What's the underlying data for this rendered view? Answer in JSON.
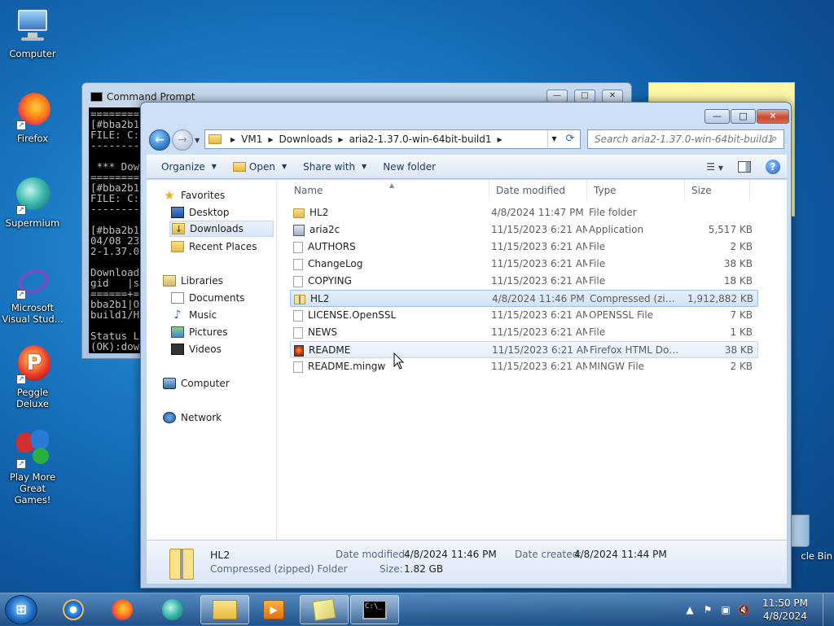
{
  "desktop": {
    "icons": [
      {
        "label": "Computer"
      },
      {
        "label": "Firefox"
      },
      {
        "label": "Supermium"
      },
      {
        "label": "Microsoft Visual Stud..."
      },
      {
        "label": "Peggle Deluxe"
      },
      {
        "label": "Play More Great Games!"
      }
    ],
    "recycle_label": "cle Bin"
  },
  "cmd": {
    "title": "Command Prompt",
    "lines": "========\n[#bba2b1\nFILE: C:\n--------\n\n *** Dow\n========\n[#bba2b1\nFILE: C:\n--------\n\n[#bba2b1\n04/08 23\n2-1.37.0\n\nDownload\ngid   |s\n======+=\nbba2b1|O\nbuild1/H\n\nStatus L\n(OK):dow\n\nC:\\Users"
  },
  "explorer": {
    "address": [
      "VM1",
      "Downloads",
      "aria2-1.37.0-win-64bit-build1"
    ],
    "search_placeholder": "Search aria2-1.37.0-win-64bit-build1",
    "toolbar": {
      "organize": "Organize",
      "open": "Open",
      "share_with": "Share with",
      "new_folder": "New folder"
    },
    "nav": {
      "favorites": "Favorites",
      "desktop": "Desktop",
      "downloads": "Downloads",
      "recent": "Recent Places",
      "libraries": "Libraries",
      "documents": "Documents",
      "music": "Music",
      "pictures": "Pictures",
      "videos": "Videos",
      "computer": "Computer",
      "network": "Network"
    },
    "columns": {
      "name": "Name",
      "date": "Date modified",
      "type": "Type",
      "size": "Size"
    },
    "files": [
      {
        "name": "HL2",
        "date": "4/8/2024 11:47 PM",
        "type": "File folder",
        "size": "",
        "icon": "folder-icon"
      },
      {
        "name": "aria2c",
        "date": "11/15/2023 6:21 AM",
        "type": "Application",
        "size": "5,517 KB",
        "icon": "application-icon"
      },
      {
        "name": "AUTHORS",
        "date": "11/15/2023 6:21 AM",
        "type": "File",
        "size": "2 KB",
        "icon": "file-icon"
      },
      {
        "name": "ChangeLog",
        "date": "11/15/2023 6:21 AM",
        "type": "File",
        "size": "38 KB",
        "icon": "file-icon"
      },
      {
        "name": "COPYING",
        "date": "11/15/2023 6:21 AM",
        "type": "File",
        "size": "18 KB",
        "icon": "file-icon"
      },
      {
        "name": "HL2",
        "date": "4/8/2024 11:46 PM",
        "type": "Compressed (zipp...",
        "size": "1,912,882 KB",
        "icon": "zip-icon"
      },
      {
        "name": "LICENSE.OpenSSL",
        "date": "11/15/2023 6:21 AM",
        "type": "OPENSSL File",
        "size": "7 KB",
        "icon": "file-icon"
      },
      {
        "name": "NEWS",
        "date": "11/15/2023 6:21 AM",
        "type": "File",
        "size": "1 KB",
        "icon": "file-icon"
      },
      {
        "name": "README",
        "date": "11/15/2023 6:21 AM",
        "type": "Firefox HTML Doc...",
        "size": "38 KB",
        "icon": "html-icon"
      },
      {
        "name": "README.mingw",
        "date": "11/15/2023 6:21 AM",
        "type": "MINGW File",
        "size": "2 KB",
        "icon": "file-icon"
      }
    ],
    "details": {
      "name": "HL2",
      "kind": "Compressed (zipped) Folder",
      "modified_label": "Date modified:",
      "modified": "4/8/2024 11:46 PM",
      "created_label": "Date created:",
      "created": "4/8/2024 11:44 PM",
      "size_label": "Size:",
      "size": "1.82 GB"
    }
  },
  "taskbar": {
    "time": "11:50 PM",
    "date": "4/8/2024"
  },
  "colors": {
    "accent": "#1a78c2",
    "selection": "#cfe2f8"
  }
}
